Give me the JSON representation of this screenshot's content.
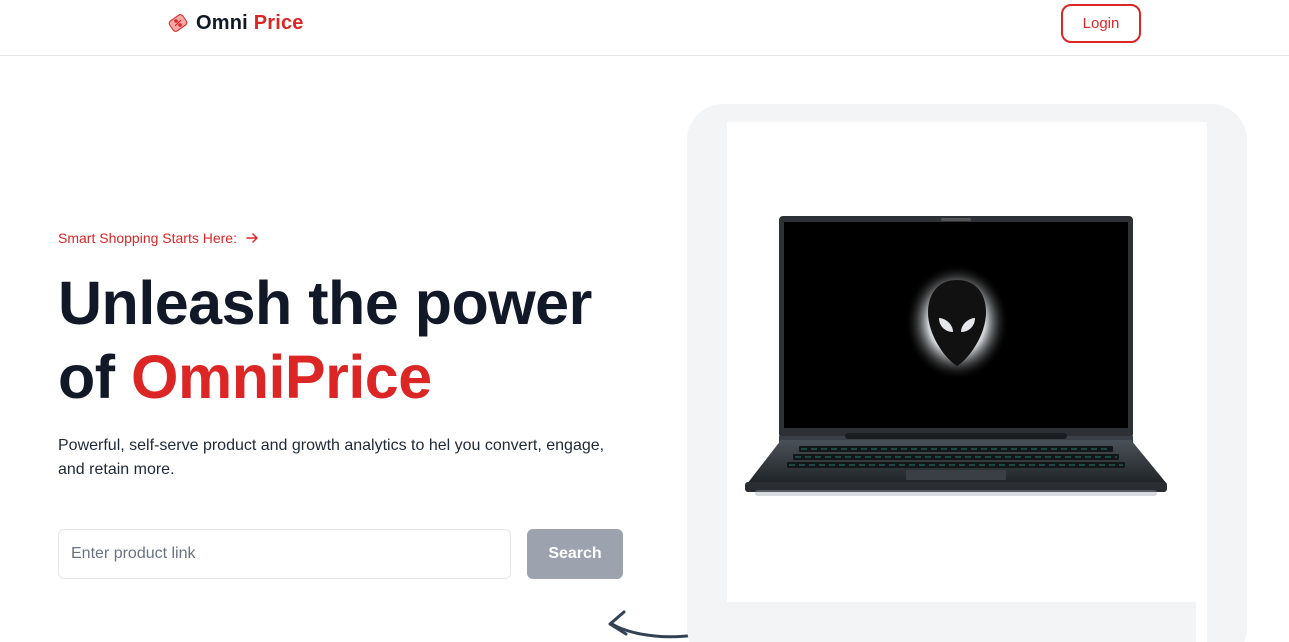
{
  "header": {
    "brand_part1": "Omni",
    "brand_part2": "Price",
    "brand_icon": "price-tag-icon",
    "login_label": "Login"
  },
  "hero": {
    "eyebrow": "Smart Shopping Starts Here:",
    "eyebrow_icon": "arrow-right-icon",
    "title_line1": "Unleash the power",
    "title_line2_prefix": "of",
    "title_accent": "OmniPrice",
    "subtitle": "Powerful, self-serve product and growth analytics to hel you convert, engage, and retain more.",
    "search": {
      "placeholder": "Enter product link",
      "value": "",
      "button_label": "Search"
    },
    "image": "laptop-product-image"
  },
  "colors": {
    "accent": "#dc2626",
    "heading": "#111827",
    "button_disabled": "#9ca3af",
    "frame_bg": "#f3f4f6"
  }
}
